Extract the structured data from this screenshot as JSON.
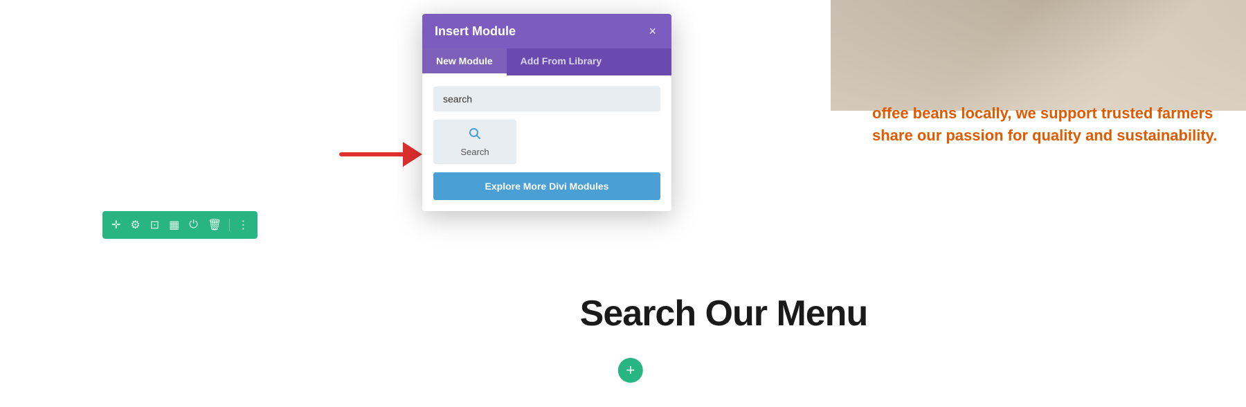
{
  "modal": {
    "title": "Insert Module",
    "close_icon": "×",
    "tabs": [
      {
        "label": "New Module",
        "active": true
      },
      {
        "label": "Add From Library",
        "active": false
      }
    ],
    "search_placeholder": "search",
    "search_button_label": "Search",
    "explore_button_label": "Explore More Divi Modules"
  },
  "page": {
    "orange_text": "offee beans locally, we support trusted farmers share our passion for quality and sustainability.",
    "bottom_heading": "Search Our Menu",
    "add_button_label": "+"
  },
  "toolbar": {
    "icons": [
      "✛",
      "⚙",
      "⊡",
      "▦",
      "⏻",
      "🗑",
      "⋮"
    ]
  },
  "arrow": {
    "color": "#e03030"
  }
}
